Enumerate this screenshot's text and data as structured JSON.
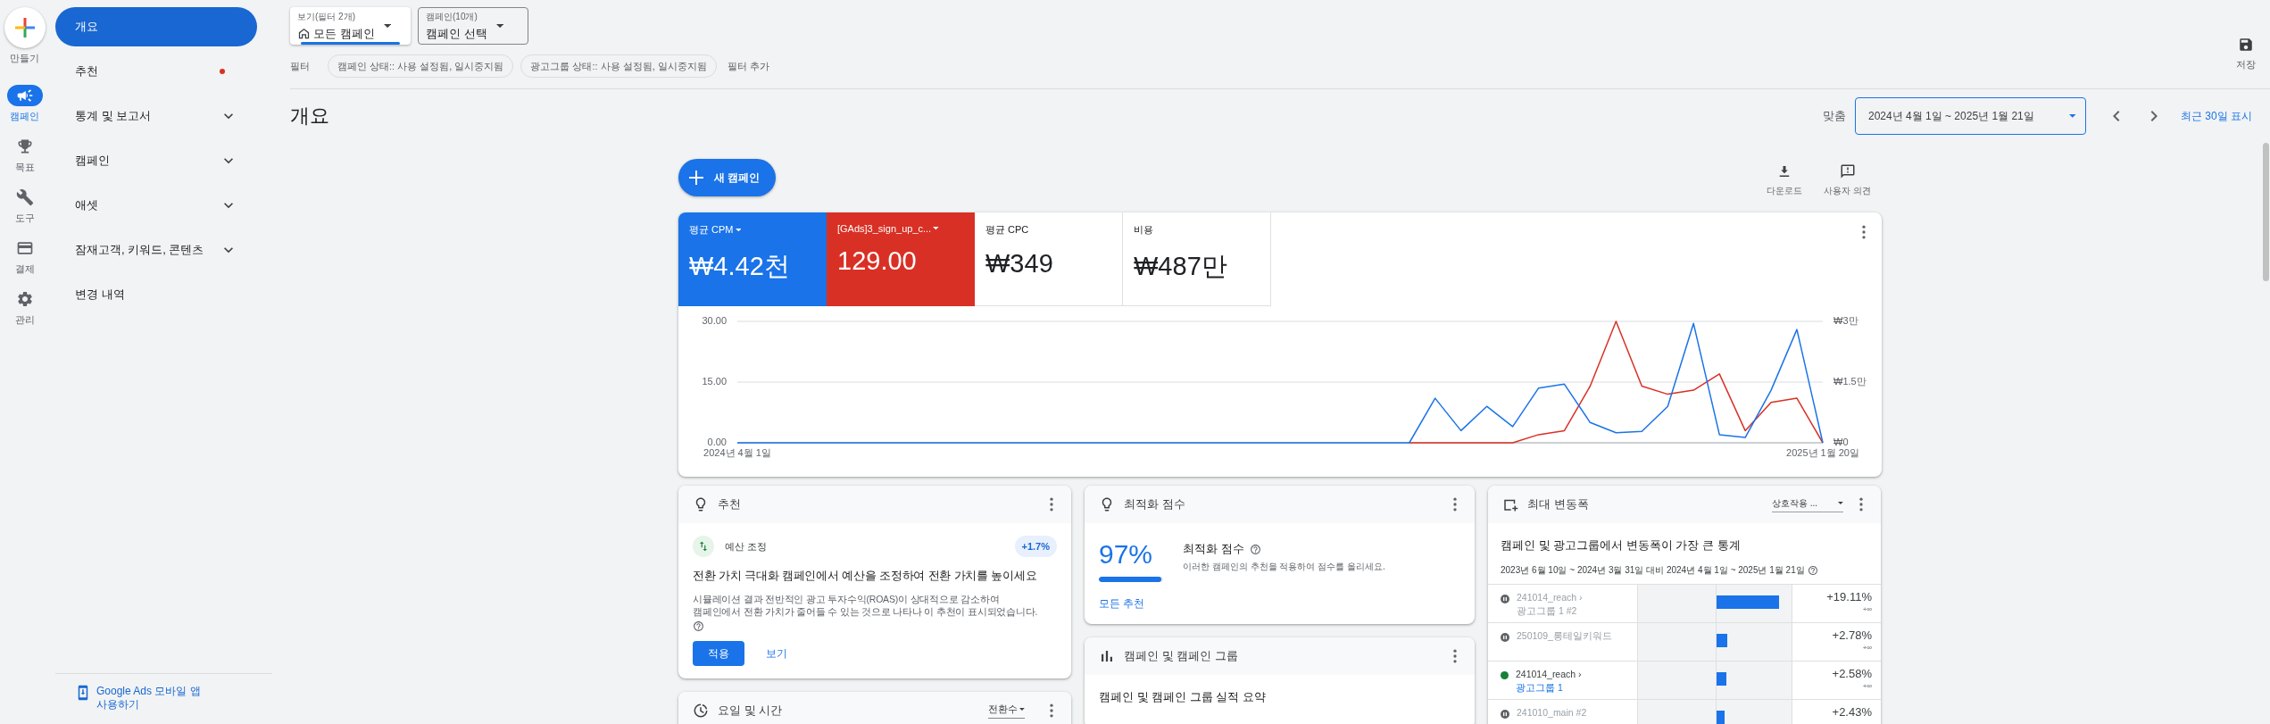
{
  "rail": {
    "create_label": "만들기",
    "items": [
      {
        "label": "캠페인",
        "selected": true
      },
      {
        "label": "목표",
        "selected": false
      },
      {
        "label": "도구",
        "selected": false
      },
      {
        "label": "결제",
        "selected": false
      },
      {
        "label": "관리",
        "selected": false
      }
    ]
  },
  "sidebar": {
    "items": [
      {
        "label": "개요",
        "selected": true,
        "expandable": false,
        "notification": false
      },
      {
        "label": "추천",
        "selected": false,
        "expandable": false,
        "notification": true
      },
      {
        "label": "통계 및 보고서",
        "selected": false,
        "expandable": true,
        "notification": false
      },
      {
        "label": "캠페인",
        "selected": false,
        "expandable": true,
        "notification": false
      },
      {
        "label": "애셋",
        "selected": false,
        "expandable": true,
        "notification": false
      },
      {
        "label": "잠재고객, 키워드, 콘텐츠",
        "selected": false,
        "expandable": true,
        "notification": false
      },
      {
        "label": "변경 내역",
        "selected": false,
        "expandable": false,
        "notification": false
      }
    ],
    "mobile_link": "Google Ads 모바일 앱 사용하기"
  },
  "toolbar": {
    "view_selector": {
      "caption": "보기(필터 2개)",
      "value": "모든 캠페인"
    },
    "campaign_selector": {
      "caption": "캠페인(10개)",
      "value": "캠페인 선택"
    },
    "filter_label": "필터",
    "filters": [
      "캠페인 상태:: 사용 설정됨, 일시중지됨",
      "광고그룹 상태:: 사용 설정됨, 일시중지됨"
    ],
    "add_filter": "필터 추가",
    "save_label": "저장"
  },
  "page_title": "개요",
  "date_range": {
    "preset": "맞춤",
    "value": "2024년 4월 1일 ~ 2025년 1월 21일",
    "link": "최근 30일 표시"
  },
  "actions": {
    "new_campaign": "새 캠페인",
    "download": "다운로드",
    "feedback": "사용자 의견"
  },
  "metrics": [
    {
      "label": "평균 CPM",
      "value": "₩4.42천",
      "selected": true,
      "color": "#1a73e8"
    },
    {
      "label": "[GAds]3_sign_up_c...",
      "value": "129.00",
      "selected": true,
      "color": "#d93025"
    },
    {
      "label": "평균 CPC",
      "value": "₩349",
      "selected": false
    },
    {
      "label": "비용",
      "value": "₩487만",
      "selected": false
    }
  ],
  "chart_data": {
    "type": "line",
    "categories": [
      "2024년 4월 1일",
      null,
      null,
      null,
      null,
      null,
      null,
      null,
      null,
      null,
      null,
      null,
      null,
      null,
      null,
      null,
      null,
      null,
      null,
      null,
      null,
      null,
      null,
      null,
      null,
      null,
      null,
      null,
      null,
      null,
      null,
      null,
      null,
      null,
      null,
      null,
      null,
      null,
      null,
      null,
      null,
      null,
      "2025년 1월 20일"
    ],
    "ylim": [
      0,
      30
    ],
    "yticks": [
      {
        "value": 0,
        "label": "0.00"
      },
      {
        "value": 15,
        "label": "15.00"
      },
      {
        "value": 30,
        "label": "30.00"
      }
    ],
    "y2lim": [
      0,
      3
    ],
    "y2ticks": [
      {
        "value": 0,
        "label": "₩0"
      },
      {
        "value": 1.5,
        "label": "₩1.5만"
      },
      {
        "value": 3,
        "label": "₩3만"
      }
    ],
    "series": [
      {
        "color": "#d93025",
        "values": [
          null,
          null,
          null,
          null,
          null,
          null,
          null,
          null,
          null,
          null,
          null,
          null,
          null,
          null,
          null,
          null,
          null,
          null,
          null,
          null,
          null,
          null,
          null,
          null,
          null,
          null,
          0,
          0,
          0,
          0,
          0,
          2,
          3,
          14,
          30,
          14,
          12,
          13,
          17,
          3,
          10,
          11,
          0
        ]
      },
      {
        "color": "#1a73e8",
        "axis": "y2",
        "values": [
          0,
          0,
          0,
          0,
          0,
          0,
          0,
          0,
          0,
          0,
          0,
          0,
          0,
          0,
          0,
          0,
          0,
          0,
          0,
          0,
          0,
          0,
          0,
          0,
          0,
          0,
          0,
          1.1,
          0.3,
          0.9,
          0.4,
          1.35,
          1.45,
          0.5,
          0.25,
          0.28,
          0.9,
          2.95,
          0.2,
          0.13,
          1.3,
          2.8,
          0
        ]
      }
    ]
  },
  "recommendations": {
    "title": "추천",
    "category": "예산 조정",
    "change": "+1.7%",
    "headline": "전환 가치 극대화 캠페인에서 예산을 조정하여 전환 가치를 높이세요",
    "description": "시뮬레이션 결과 전반적인 광고 투자수익(ROAS)이 상대적으로 감소하여\n캠페인에서 전환 가치가 줄어들 수 있는 것으로 나타나 이 추천이 표시되었습니다.",
    "buttons": [
      "적용",
      "보기"
    ]
  },
  "day_time": {
    "title": "요일 및 시간",
    "metric": "전환수"
  },
  "optimization": {
    "title": "최적화 점수",
    "score": "97%",
    "level": 0.97,
    "heading": "최적화 점수",
    "description": "이러한 캠페인의 추천을 적용하여 점수를 올리세요.",
    "link": "모든 추천"
  },
  "campaign_groups": {
    "title": "캠페인 및 캠페인 그룹",
    "subtitle": "캠페인 및 캠페인 그룹 실적 요약"
  },
  "biggest_changes": {
    "title": "최대 변동폭",
    "metric": "상호작용 ...",
    "heading": "캠페인 및 광고그룹에서 변동폭이 가장 큰 통계",
    "period": "2023년 6월 10일 ~ 2024년 3월 31일 대비 2024년 4월 1일 ~ 2025년 1월 21일",
    "rows": [
      {
        "kind": "paused",
        "campaign": "241014_reach ›",
        "ad_group": "광고그룹 1 #2",
        "level": 0.83,
        "change": "+19.11%",
        "base": "+∞"
      },
      {
        "kind": "paused",
        "campaign": "250109_롱테일키워드",
        "level": 0.14,
        "change": "+2.78%",
        "base": "+∞"
      },
      {
        "kind": "enabled",
        "campaign": "241014_reach ›",
        "ad_group": "광고그룹 1",
        "level": 0.125,
        "change": "+2.58%",
        "base": "+∞"
      },
      {
        "kind": "paused",
        "campaign": "241010_main #2",
        "level": 0.11,
        "change": "+2.43%"
      }
    ]
  }
}
